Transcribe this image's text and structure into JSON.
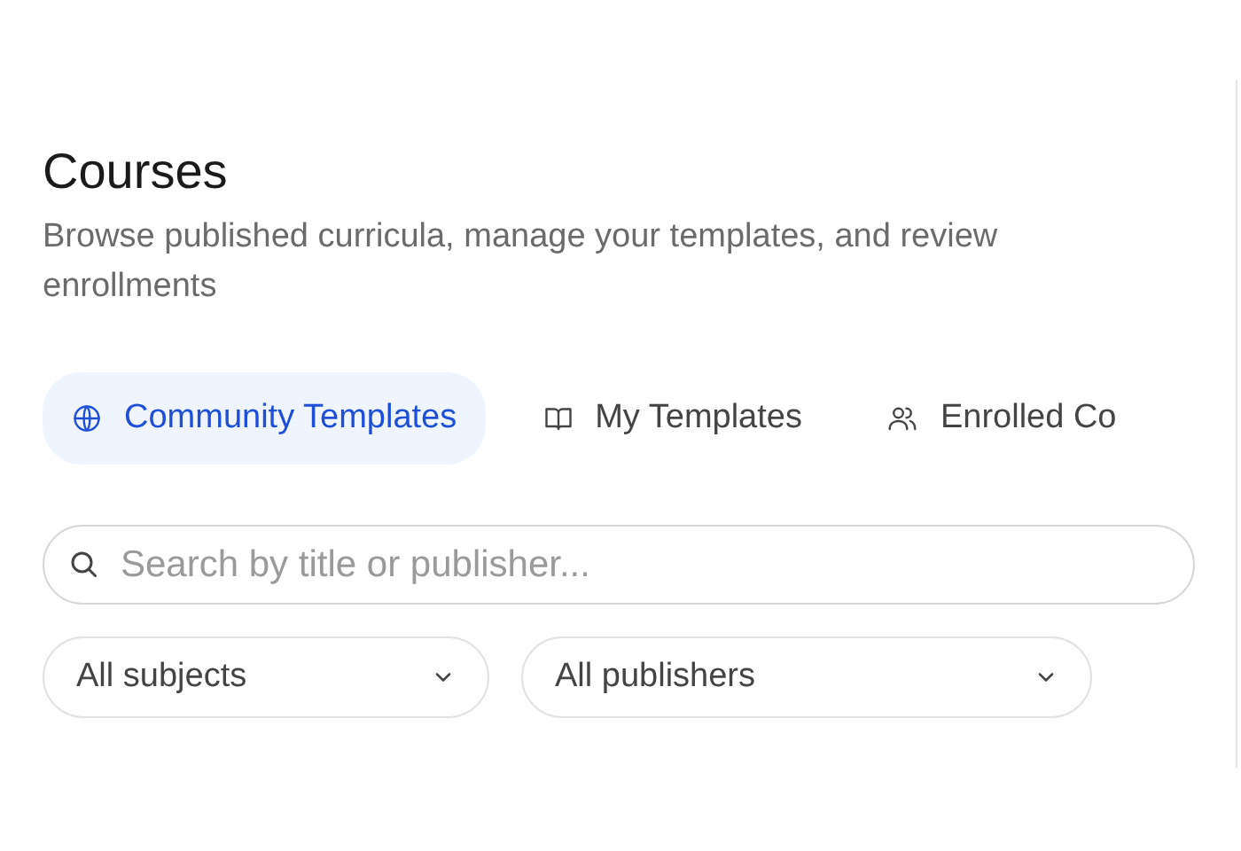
{
  "header": {
    "title": "Courses",
    "subtitle": "Browse published curricula, manage your templates, and review enrollments"
  },
  "tabs": [
    {
      "label": "Community Templates",
      "selected": true
    },
    {
      "label": "My Templates",
      "selected": false
    },
    {
      "label": "Enrolled Co",
      "selected": false
    }
  ],
  "search": {
    "placeholder": "Search by title or publisher..."
  },
  "filters": [
    {
      "value": "All subjects"
    },
    {
      "value": "All publishers"
    }
  ]
}
